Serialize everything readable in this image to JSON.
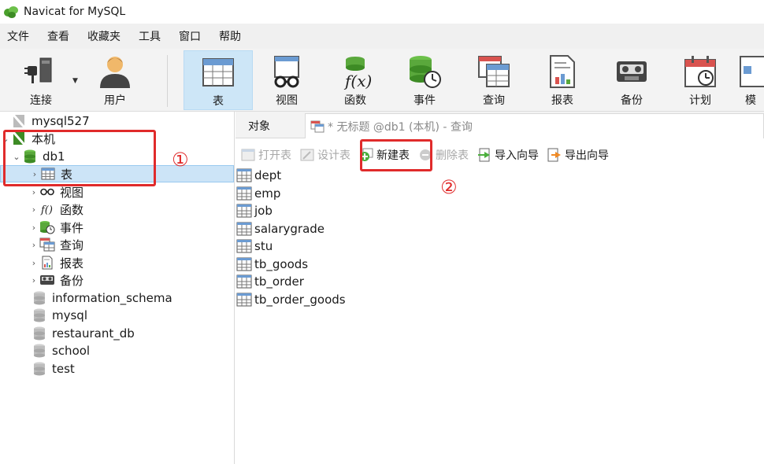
{
  "window": {
    "title": "Navicat for MySQL"
  },
  "menu": [
    "文件",
    "查看",
    "收藏夹",
    "工具",
    "窗口",
    "帮助"
  ],
  "toolbar": {
    "items": [
      {
        "label": "连接",
        "icon": "plug-connect-icon"
      },
      {
        "label": "用户",
        "icon": "user-icon"
      },
      {
        "label": "表",
        "icon": "table-icon",
        "active": true
      },
      {
        "label": "视图",
        "icon": "view-glasses-icon"
      },
      {
        "label": "函数",
        "icon": "function-icon"
      },
      {
        "label": "事件",
        "icon": "event-clock-icon"
      },
      {
        "label": "查询",
        "icon": "query-icon"
      },
      {
        "label": "报表",
        "icon": "report-icon"
      },
      {
        "label": "备份",
        "icon": "backup-tape-icon"
      },
      {
        "label": "计划",
        "icon": "calendar-schedule-icon"
      },
      {
        "label": "模",
        "icon": "model-icon"
      }
    ]
  },
  "tree": {
    "connection_top": "mysql527",
    "connection_local": "本机",
    "db_open": "db1",
    "children": [
      "表",
      "视图",
      "函数",
      "事件",
      "查询",
      "报表",
      "备份"
    ],
    "other_dbs": [
      "information_schema",
      "mysql",
      "restaurant_db",
      "school",
      "test"
    ]
  },
  "tabs": {
    "objects": "对象",
    "query": "* 无标题 @db1 (本机) - 查询"
  },
  "object_toolbar": {
    "open_table": "打开表",
    "design_table": "设计表",
    "new_table": "新建表",
    "delete_table": "删除表",
    "import_wizard": "导入向导",
    "export_wizard": "导出向导"
  },
  "tables": [
    "dept",
    "emp",
    "job",
    "salarygrade",
    "stu",
    "tb_goods",
    "tb_order",
    "tb_order_goods"
  ],
  "annotations": {
    "step1": "①",
    "step2": "②"
  },
  "colors": {
    "accent": "#cde6f7",
    "annotation": "#e02b2b",
    "db_green": "#5aa83c"
  }
}
